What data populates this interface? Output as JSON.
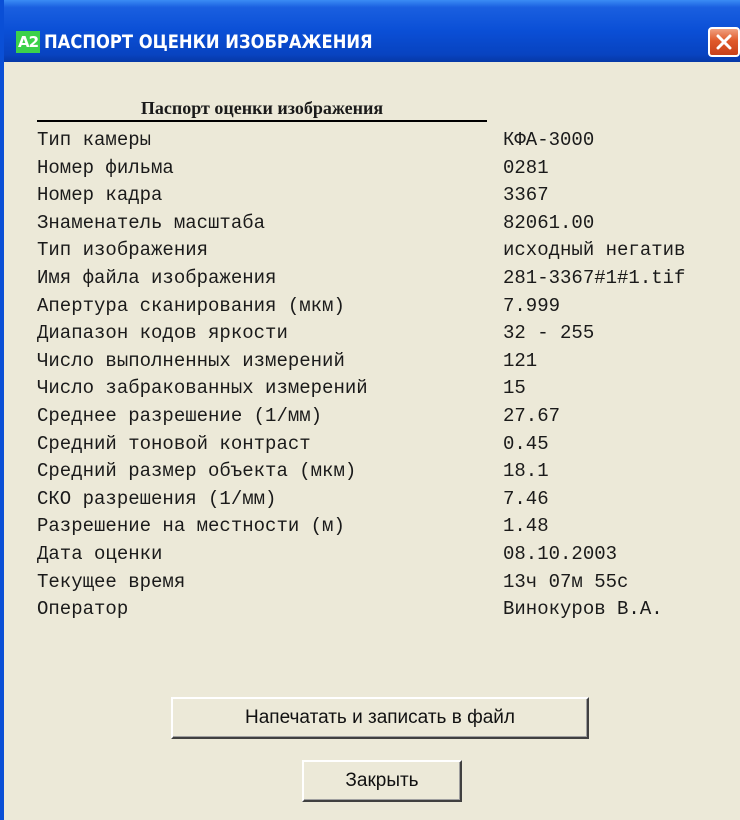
{
  "window": {
    "icon_text": "A2",
    "title": "ПАСПОРТ ОЦЕНКИ ИЗОБРАЖЕНИЯ"
  },
  "report": {
    "header": "Паспорт оценки изображения",
    "rows": [
      {
        "label": "Тип камеры",
        "value": "КФА-3000"
      },
      {
        "label": "Номер фильма",
        "value": "0281"
      },
      {
        "label": "Номер кадра",
        "value": "3367"
      },
      {
        "label": "Знаменатель масштаба",
        "value": "82061.00"
      },
      {
        "label": "Тип изображения",
        "value": "исходный негатив"
      },
      {
        "label": "Имя файла изображения",
        "value": "281-3367#1#1.tif"
      },
      {
        "label": "Апертура сканирования (мкм)",
        "value": "7.999"
      },
      {
        "label": "Диапазон кодов яркости",
        "value": "32 - 255"
      },
      {
        "label": "Число выполненных измерений",
        "value": "121"
      },
      {
        "label": "Число забракованных измерений",
        "value": "15"
      },
      {
        "label": "Среднее разрешение (1/мм)",
        "value": "27.67"
      },
      {
        "label": "Средний тоновой контраст",
        "value": "0.45"
      },
      {
        "label": "Средний размер объекта (мкм)",
        "value": "18.1"
      },
      {
        "label": "СКО разрешения (1/мм)",
        "value": "7.46"
      },
      {
        "label": "Разрешение на местности (м)",
        "value": "1.48"
      },
      {
        "label": "Дата оценки",
        "value": "08.10.2003"
      },
      {
        "label": "Текущее время",
        "value": "13ч 07м 55с"
      },
      {
        "label": "Оператор",
        "value": "Винокуров В.А."
      }
    ]
  },
  "buttons": {
    "print_label": "Напечатать и записать в файл",
    "close_label": "Закрыть"
  },
  "colors": {
    "titlebar": "#0a4fd6",
    "window_bg": "#ece9d8",
    "close_button": "#e05a2a",
    "app_icon": "#3cd14a"
  },
  "icons": {
    "app": "a2-app-icon",
    "close": "close-icon"
  }
}
